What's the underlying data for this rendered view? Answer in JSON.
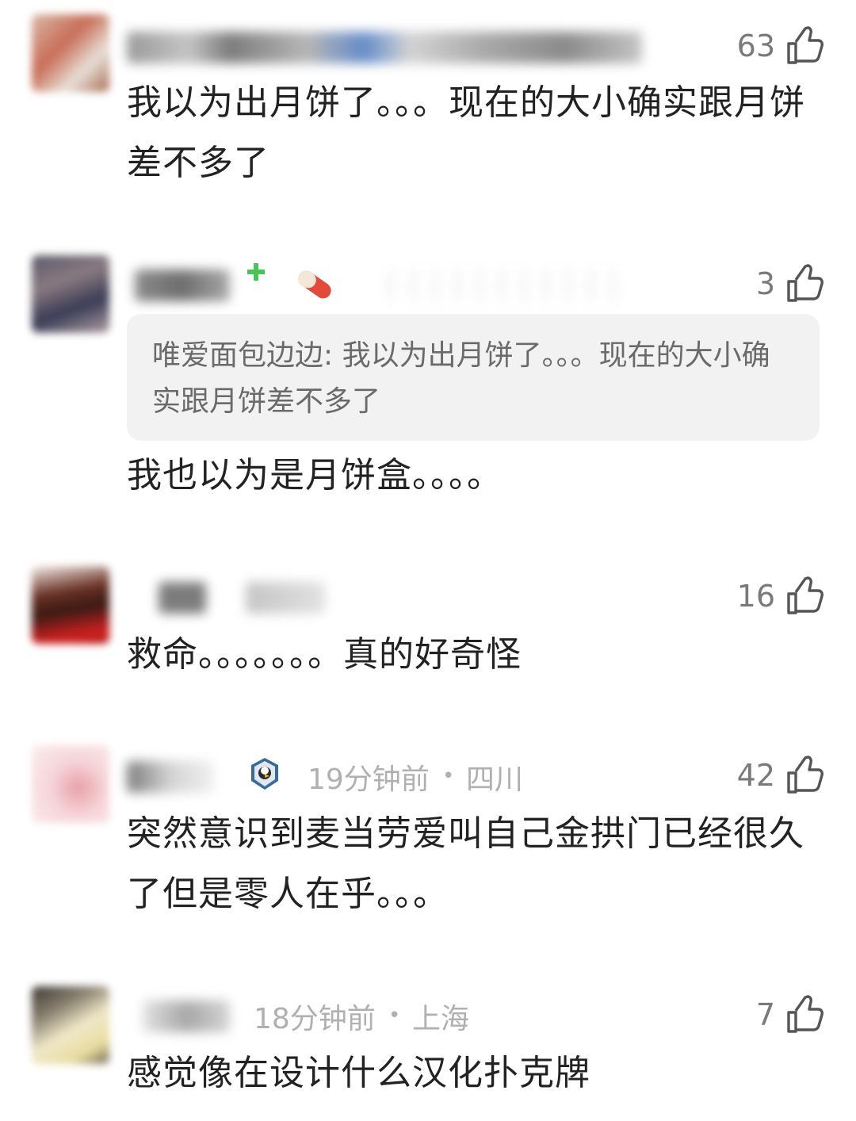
{
  "comments": [
    {
      "likes": "63",
      "text": "我以为出月饼了。。。现在的大小确实跟月饼差不多了"
    },
    {
      "likes": "3",
      "quote_author": "唯爱面包边边",
      "quote_sep": ": ",
      "quote_text": "我以为出月饼了。。。现在的大小确实跟月饼差不多了",
      "text": "我也以为是月饼盒。。。。"
    },
    {
      "likes": "16",
      "text": "救命。。。。。。。真的好奇怪"
    },
    {
      "likes": "42",
      "time": "19分钟前",
      "dot": "•",
      "location": "四川",
      "text": "突然意识到麦当劳爱叫自己金拱门已经很久了但是零人在乎。。。"
    },
    {
      "likes": "7",
      "time": "18分钟前",
      "dot": "•",
      "location": "上海",
      "text": "感觉像在设计什么汉化扑克牌"
    }
  ],
  "icons": {
    "like": "thumbs-up-outline-icon",
    "pill_badge": "pill-badge-icon",
    "eagle_badge": "eagle-badge-icon",
    "plus_badge": "green-plus-icon"
  },
  "colors": {
    "text": "#222222",
    "meta": "#b0b0b0",
    "quote_bg": "#f2f2f2",
    "quote_text": "#6a6a6a",
    "like_count": "#7a7a7a"
  }
}
